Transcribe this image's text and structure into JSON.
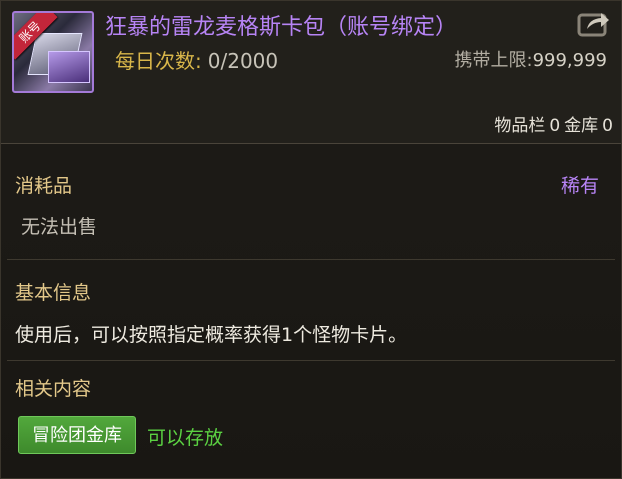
{
  "item": {
    "name": "狂暴的雷龙麦格斯卡包（账号绑定）",
    "badge": "账号",
    "daily_label": "每日次数:",
    "daily_value": "0/2000",
    "limit_label": "携带上限:",
    "limit_value": "999,999",
    "inventory_label": "物品栏",
    "inventory_value": "0",
    "vault_label": "金库",
    "vault_value": "0",
    "icon": "card-pack-icon"
  },
  "category": {
    "type": "消耗品",
    "rarity": "稀有",
    "sell_status": "无法出售"
  },
  "basic_info": {
    "title": "基本信息",
    "description": "使用后，可以按照指定概率获得1个怪物卡片。"
  },
  "related": {
    "title": "相关内容",
    "button_label": "冒险团金库",
    "status": "可以存放"
  },
  "colors": {
    "title": "#b784f5",
    "rarity": "#b784f5",
    "section_heading": "#e3c88a",
    "storable": "#5bd142",
    "button_bg": "#4a9a36",
    "badge": "#c2263a"
  },
  "icons": [
    "card-pack-icon",
    "share-icon"
  ]
}
